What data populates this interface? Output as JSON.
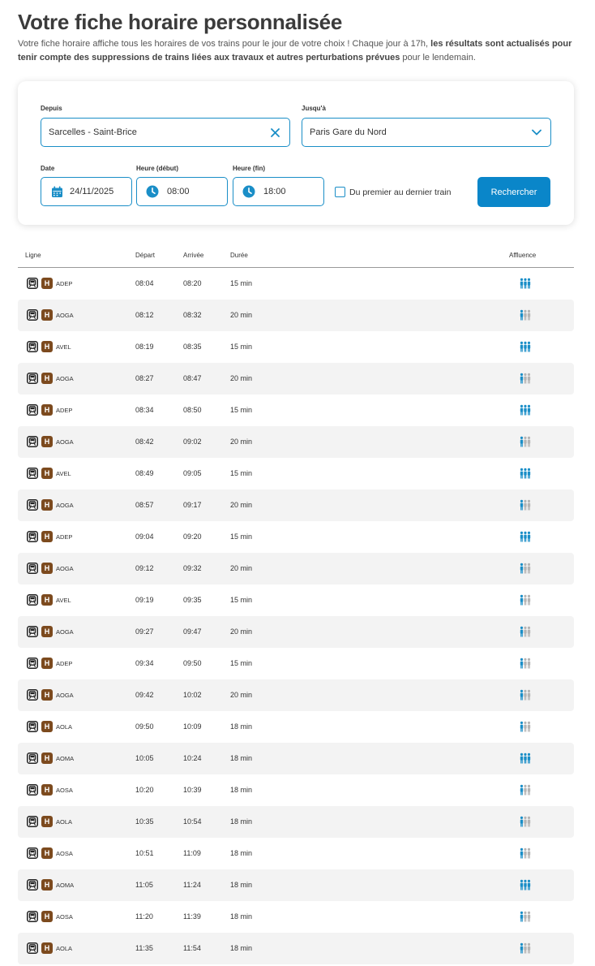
{
  "page": {
    "title": "Votre fiche horaire personnalisée",
    "intro_plain_1": "Votre fiche horaire affiche tous les horaires de vos trains pour le jour de votre choix ! Chaque jour à 17h, ",
    "intro_bold": "les résultats sont actualisés pour tenir compte des suppressions de trains liées aux travaux et autres perturbations prévues",
    "intro_plain_2": " pour le lendemain."
  },
  "search": {
    "from_label": "Depuis",
    "from_value": "Sarcelles - Saint-Brice",
    "to_label": "Jusqu'à",
    "to_value": "Paris Gare du Nord",
    "date_label": "Date",
    "date_value": "24/11/2025",
    "start_label": "Heure (début)",
    "start_value": "08:00",
    "end_label": "Heure (fin)",
    "end_value": "18:00",
    "checkbox_label": "Du premier au dernier train",
    "checkbox_checked": false,
    "button_label": "Rechercher"
  },
  "table": {
    "headers": {
      "line": "Ligne",
      "departure": "Départ",
      "arrival": "Arrivée",
      "duration": "Durée",
      "crowd": "Affluence"
    },
    "line_badge": "H",
    "icons": {
      "train": "train-icon",
      "crowd": "crowd-icon"
    },
    "colors": {
      "badge": "#7c4a1e",
      "accent": "#1a8ec7",
      "crowd_full": "#1a8ec7",
      "crowd_grey": "#b4b4b4"
    },
    "rows": [
      {
        "mission": "ADEP",
        "departure": "08:04",
        "arrival": "08:20",
        "duration": "15 min",
        "crowd_level": 3
      },
      {
        "mission": "AOGA",
        "departure": "08:12",
        "arrival": "08:32",
        "duration": "20 min",
        "crowd_level": 1
      },
      {
        "mission": "AVEL",
        "departure": "08:19",
        "arrival": "08:35",
        "duration": "15 min",
        "crowd_level": 3
      },
      {
        "mission": "AOGA",
        "departure": "08:27",
        "arrival": "08:47",
        "duration": "20 min",
        "crowd_level": 1
      },
      {
        "mission": "ADEP",
        "departure": "08:34",
        "arrival": "08:50",
        "duration": "15 min",
        "crowd_level": 3
      },
      {
        "mission": "AOGA",
        "departure": "08:42",
        "arrival": "09:02",
        "duration": "20 min",
        "crowd_level": 1
      },
      {
        "mission": "AVEL",
        "departure": "08:49",
        "arrival": "09:05",
        "duration": "15 min",
        "crowd_level": 3
      },
      {
        "mission": "AOGA",
        "departure": "08:57",
        "arrival": "09:17",
        "duration": "20 min",
        "crowd_level": 1
      },
      {
        "mission": "ADEP",
        "departure": "09:04",
        "arrival": "09:20",
        "duration": "15 min",
        "crowd_level": 3
      },
      {
        "mission": "AOGA",
        "departure": "09:12",
        "arrival": "09:32",
        "duration": "20 min",
        "crowd_level": 1
      },
      {
        "mission": "AVEL",
        "departure": "09:19",
        "arrival": "09:35",
        "duration": "15 min",
        "crowd_level": 1
      },
      {
        "mission": "AOGA",
        "departure": "09:27",
        "arrival": "09:47",
        "duration": "20 min",
        "crowd_level": 1
      },
      {
        "mission": "ADEP",
        "departure": "09:34",
        "arrival": "09:50",
        "duration": "15 min",
        "crowd_level": 1
      },
      {
        "mission": "AOGA",
        "departure": "09:42",
        "arrival": "10:02",
        "duration": "20 min",
        "crowd_level": 1
      },
      {
        "mission": "AOLA",
        "departure": "09:50",
        "arrival": "10:09",
        "duration": "18 min",
        "crowd_level": 1
      },
      {
        "mission": "AOMA",
        "departure": "10:05",
        "arrival": "10:24",
        "duration": "18 min",
        "crowd_level": 3
      },
      {
        "mission": "AOSA",
        "departure": "10:20",
        "arrival": "10:39",
        "duration": "18 min",
        "crowd_level": 1
      },
      {
        "mission": "AOLA",
        "departure": "10:35",
        "arrival": "10:54",
        "duration": "18 min",
        "crowd_level": 1
      },
      {
        "mission": "AOSA",
        "departure": "10:51",
        "arrival": "11:09",
        "duration": "18 min",
        "crowd_level": 1
      },
      {
        "mission": "AOMA",
        "departure": "11:05",
        "arrival": "11:24",
        "duration": "18 min",
        "crowd_level": 3
      },
      {
        "mission": "AOSA",
        "departure": "11:20",
        "arrival": "11:39",
        "duration": "18 min",
        "crowd_level": 1
      },
      {
        "mission": "AOLA",
        "departure": "11:35",
        "arrival": "11:54",
        "duration": "18 min",
        "crowd_level": 1
      }
    ]
  }
}
